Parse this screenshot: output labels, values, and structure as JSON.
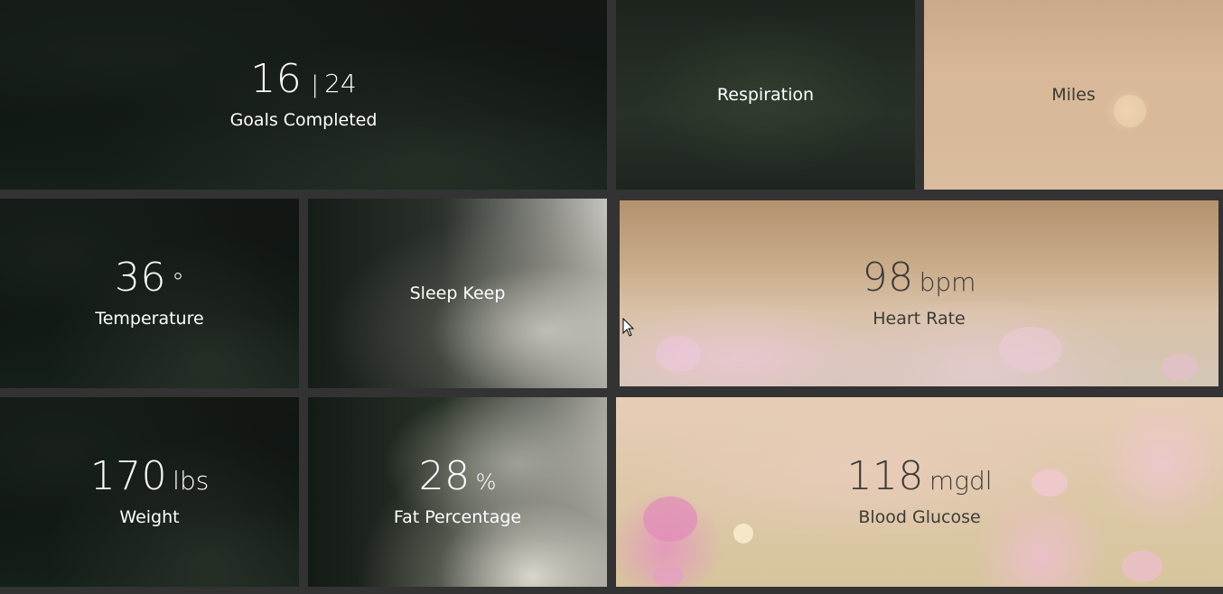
{
  "tiles": {
    "goals": {
      "value": "16",
      "separator": "|",
      "total": "24",
      "label": "Goals Completed"
    },
    "respiration": {
      "label": "Respiration"
    },
    "miles": {
      "label": "Miles"
    },
    "temperature": {
      "value": "36",
      "unit": "°",
      "label": "Temperature"
    },
    "sleep": {
      "label": "Sleep Keep"
    },
    "heart_rate": {
      "value": "98",
      "unit": "bpm",
      "label": "Heart Rate"
    },
    "weight": {
      "value": "170",
      "unit": "lbs",
      "label": "Weight"
    },
    "fat": {
      "value": "28",
      "unit": "%",
      "label": "Fat Percentage"
    },
    "glucose": {
      "value": "118",
      "unit": "mgdl",
      "label": "Blood Glucose"
    }
  },
  "colors": {
    "gutter": "#333333",
    "light_text": "#ffffff",
    "dark_text": "#3d3a36"
  }
}
